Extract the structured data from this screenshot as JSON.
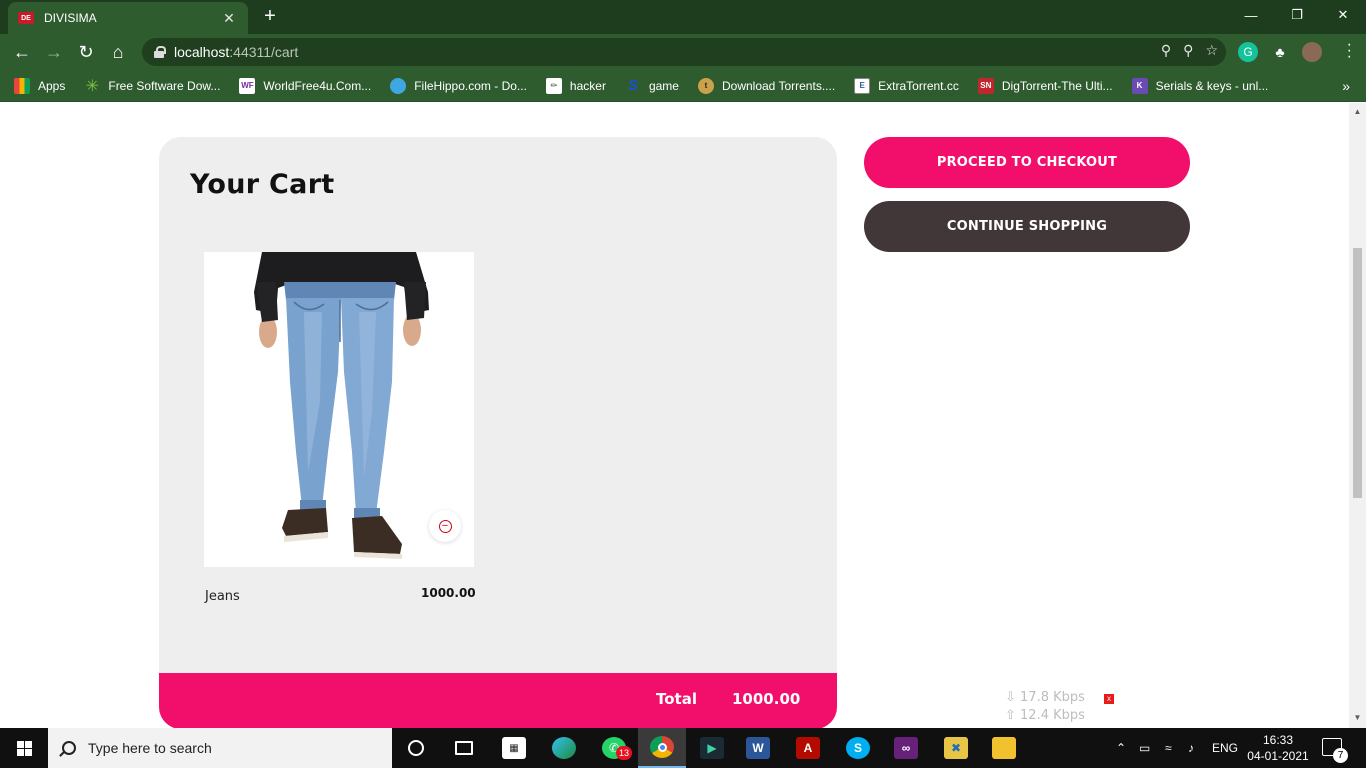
{
  "browser": {
    "tab_title": "DIVISIMA",
    "tab_favicon_text": "DE",
    "url_host": "localhost",
    "url_rest": ":44311/cart",
    "bookmarks": [
      {
        "label": "Apps",
        "icon": "apps-grid-icon",
        "color": "#e8453c"
      },
      {
        "label": "Free Software Dow...",
        "icon": "starburst-icon",
        "color": "#7cc142"
      },
      {
        "label": "WorldFree4u.Com...",
        "icon": "wf-icon",
        "color": "#ffffff"
      },
      {
        "label": "FileHippo.com - Do...",
        "icon": "hippo-icon",
        "color": "#3ea6e0"
      },
      {
        "label": "hacker",
        "icon": "page-icon",
        "color": "#ffffff"
      },
      {
        "label": "game",
        "icon": "s-logo-icon",
        "color": "#1a4fd6"
      },
      {
        "label": "Download Torrents....",
        "icon": "shield-icon",
        "color": "#c9a24a"
      },
      {
        "label": "ExtraTorrent.cc",
        "icon": "doc-icon",
        "color": "#ffffff"
      },
      {
        "label": "DigTorrent-The Ulti...",
        "icon": "sn-icon",
        "color": "#c0262d"
      },
      {
        "label": "Serials & keys - unl...",
        "icon": "serials-icon",
        "color": "#6b4bb3"
      }
    ]
  },
  "page": {
    "cart_title": "Your Cart",
    "product": {
      "name": "Jeans",
      "price": "1000.00"
    },
    "total_label": "Total",
    "total_value": "1000.00",
    "checkout_label": "PROCEED TO CHECKOUT",
    "continue_label": "CONTINUE SHOPPING",
    "accent_color": "#f20f6b",
    "dark_button_color": "#413738"
  },
  "netmeter": {
    "down": "⇩ 17.8 Kbps",
    "up": "⇧ 12.4 Kbps",
    "close": "x"
  },
  "taskbar": {
    "search_placeholder": "Type here to search",
    "whatsapp_badge": "13",
    "language": "ENG",
    "time": "16:33",
    "date": "04-01-2021",
    "notification_count": "7"
  }
}
